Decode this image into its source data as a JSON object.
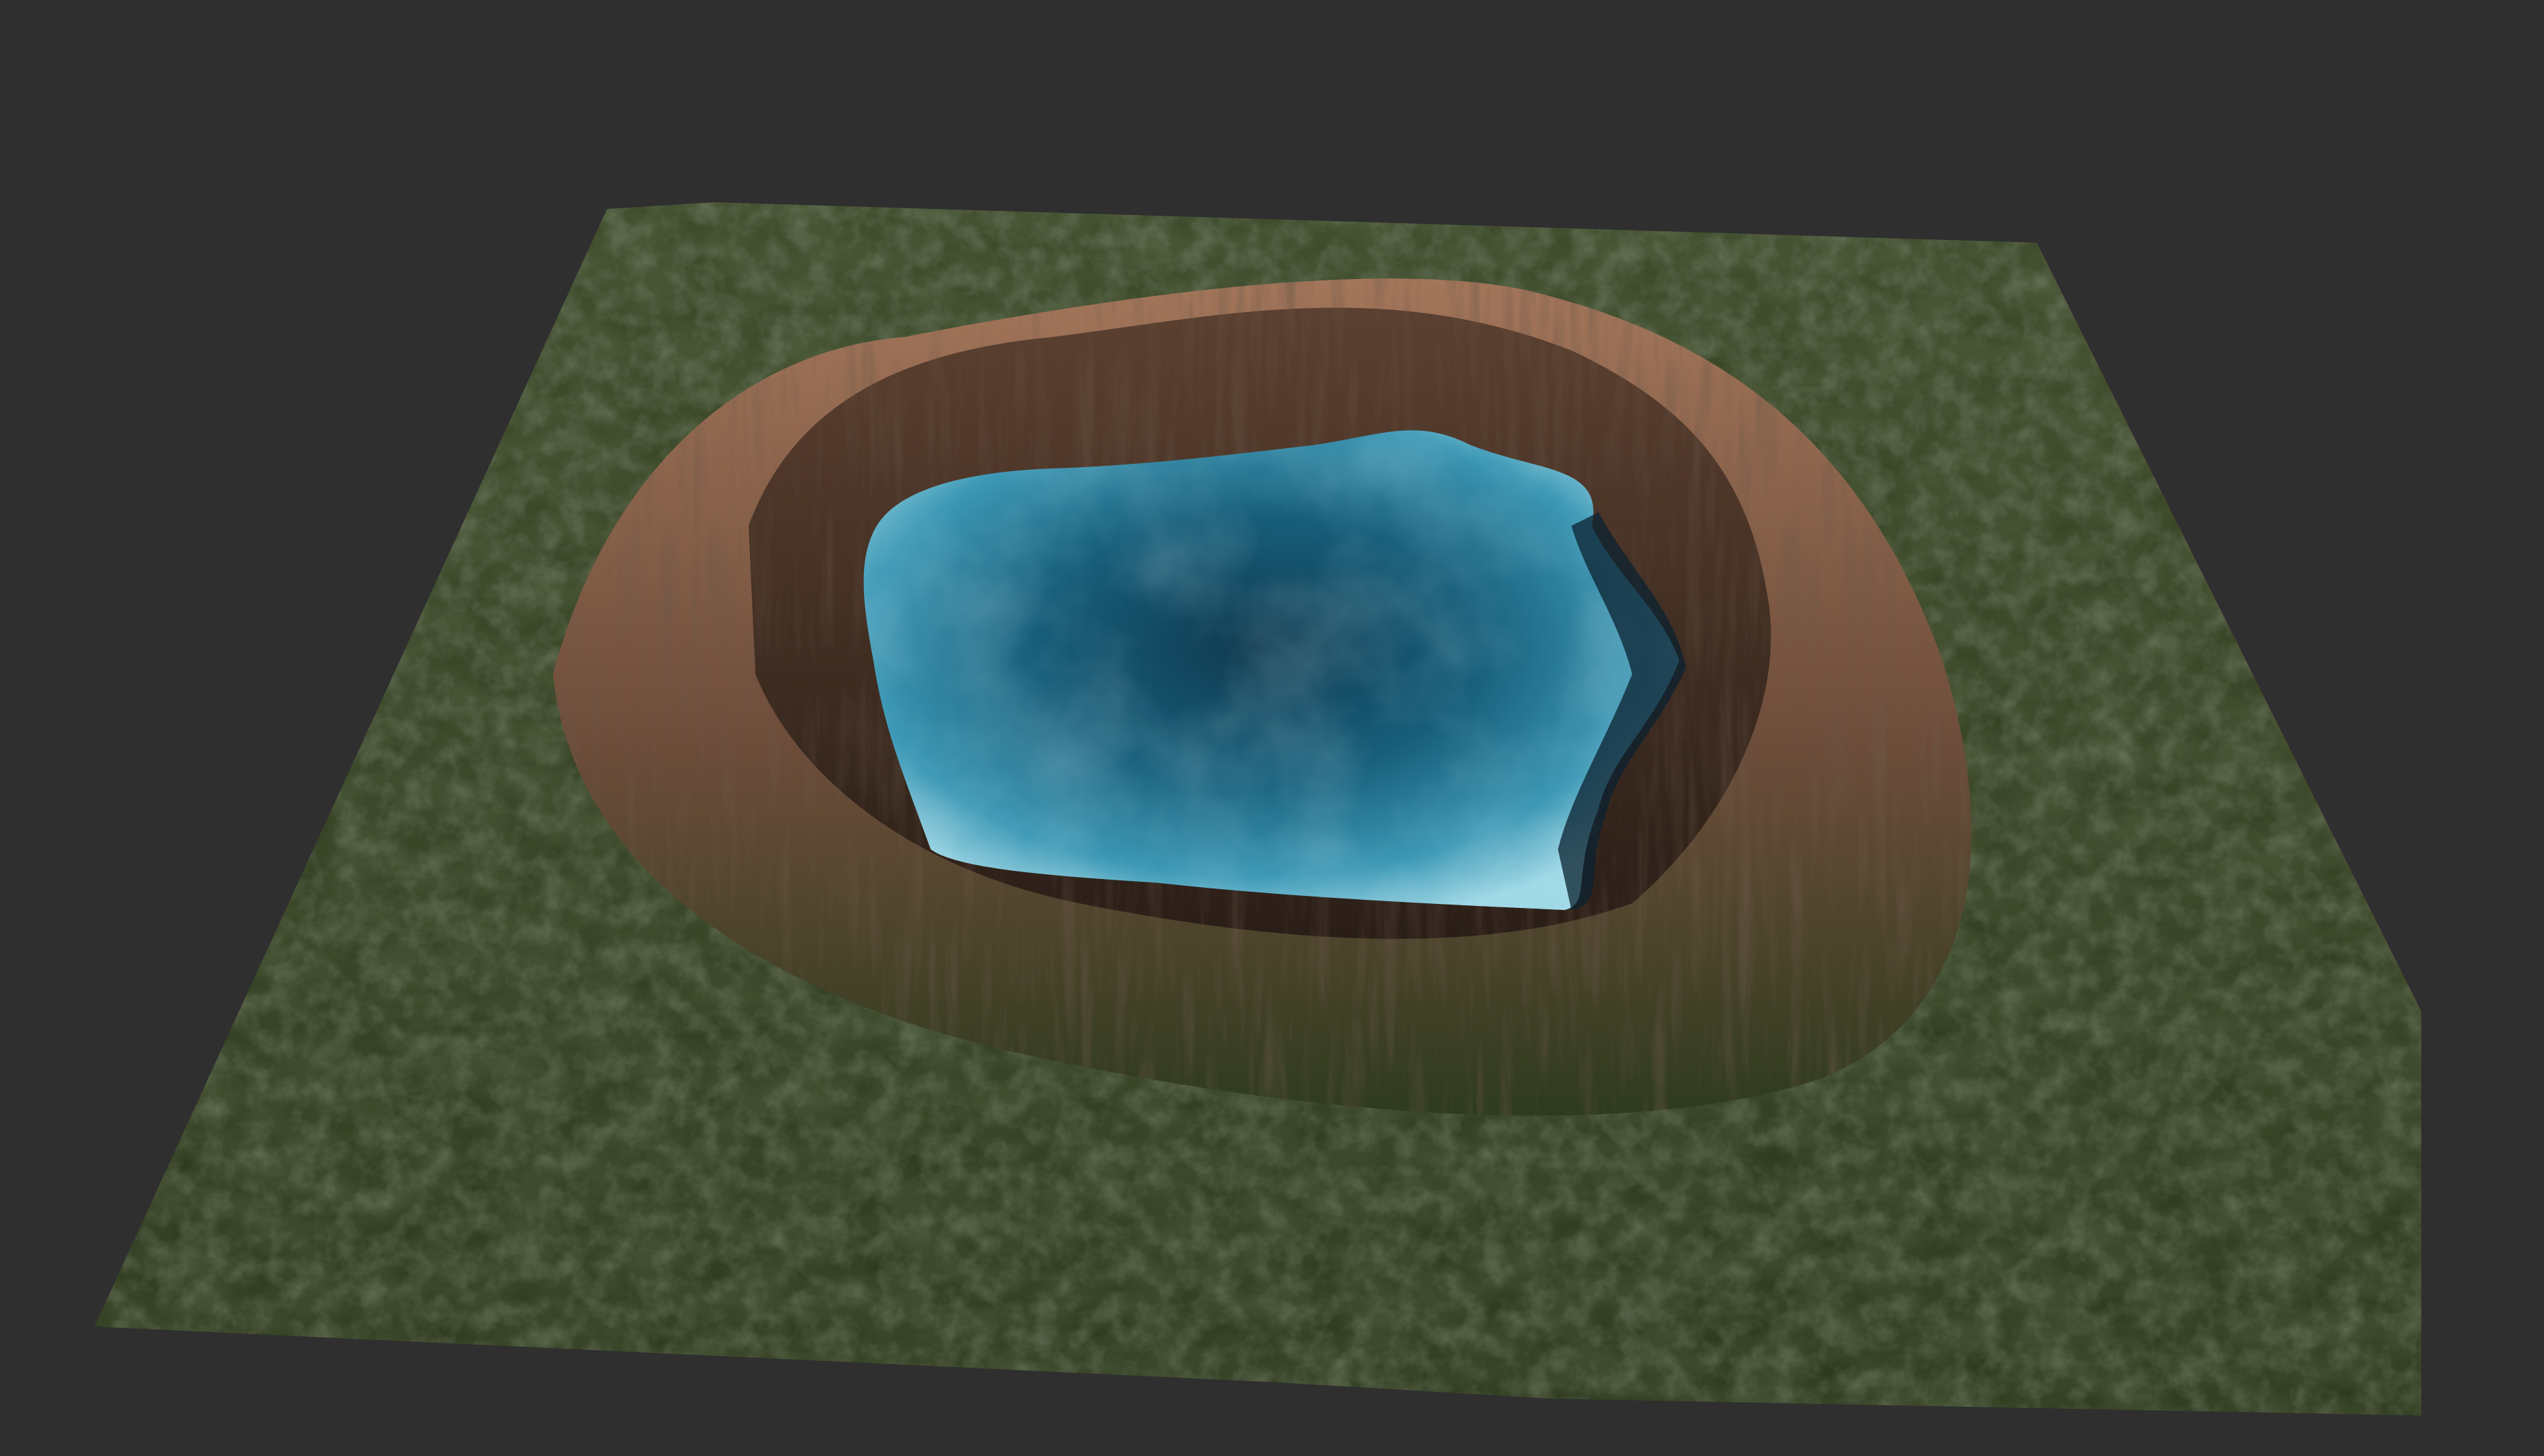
{
  "scene": {
    "background_color": "#2f2f2f",
    "subject": "terrain-crater-lake",
    "colors": {
      "forest_dark": "#1f2a16",
      "forest_mid": "#33421f",
      "forest_light": "#4d5a2c",
      "cliff_dark": "#3a2a20",
      "cliff_light": "#9a6e52",
      "lake_deep": "#123f55",
      "lake_mid": "#1d6a88",
      "lake_shallow": "#8fd0e0"
    }
  }
}
